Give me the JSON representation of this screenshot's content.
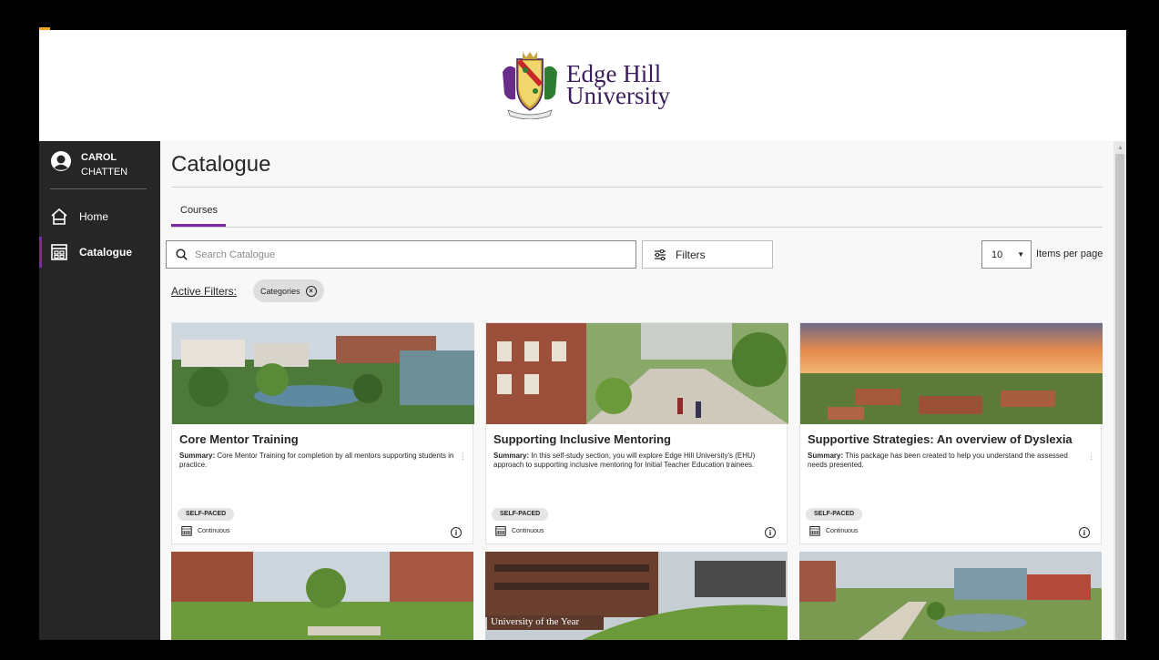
{
  "brand": {
    "line1": "Edge Hill",
    "line2": "University",
    "color": "#3b1d5c",
    "accent": "#7b2b9e"
  },
  "user": {
    "first": "CAROL",
    "last": "CHATTEN"
  },
  "nav": {
    "home": "Home",
    "catalogue": "Catalogue"
  },
  "page": {
    "title": "Catalogue",
    "tab": "Courses"
  },
  "search": {
    "placeholder": "Search Catalogue"
  },
  "filters": {
    "label": "Filters",
    "active_label": "Active Filters:",
    "chip": "Categories"
  },
  "pagination": {
    "per_page_value": "10",
    "per_page_label": "Items per page"
  },
  "cards": [
    {
      "title": "Core Mentor Training",
      "summary_label": "Summary:",
      "summary": "Core Mentor Training for completion by all mentors supporting students in practice.",
      "badge": "SELF-PACED",
      "duration": "Continuous"
    },
    {
      "title": "Supporting Inclusive Mentoring",
      "summary_label": "Summary:",
      "summary": "In this self-study section, you will explore Edge Hill University's (EHU) approach to supporting inclusive mentoring for Initial Teacher Education trainees.",
      "badge": "SELF-PACED",
      "duration": "Continuous"
    },
    {
      "title": "Supportive Strategies: An overview of Dyslexia",
      "summary_label": "Summary:",
      "summary": "This package has been created to help you understand the assessed needs presented.",
      "badge": "SELF-PACED",
      "duration": "Continuous"
    }
  ],
  "partial_cards": {
    "banner_text": "University of the Year"
  }
}
